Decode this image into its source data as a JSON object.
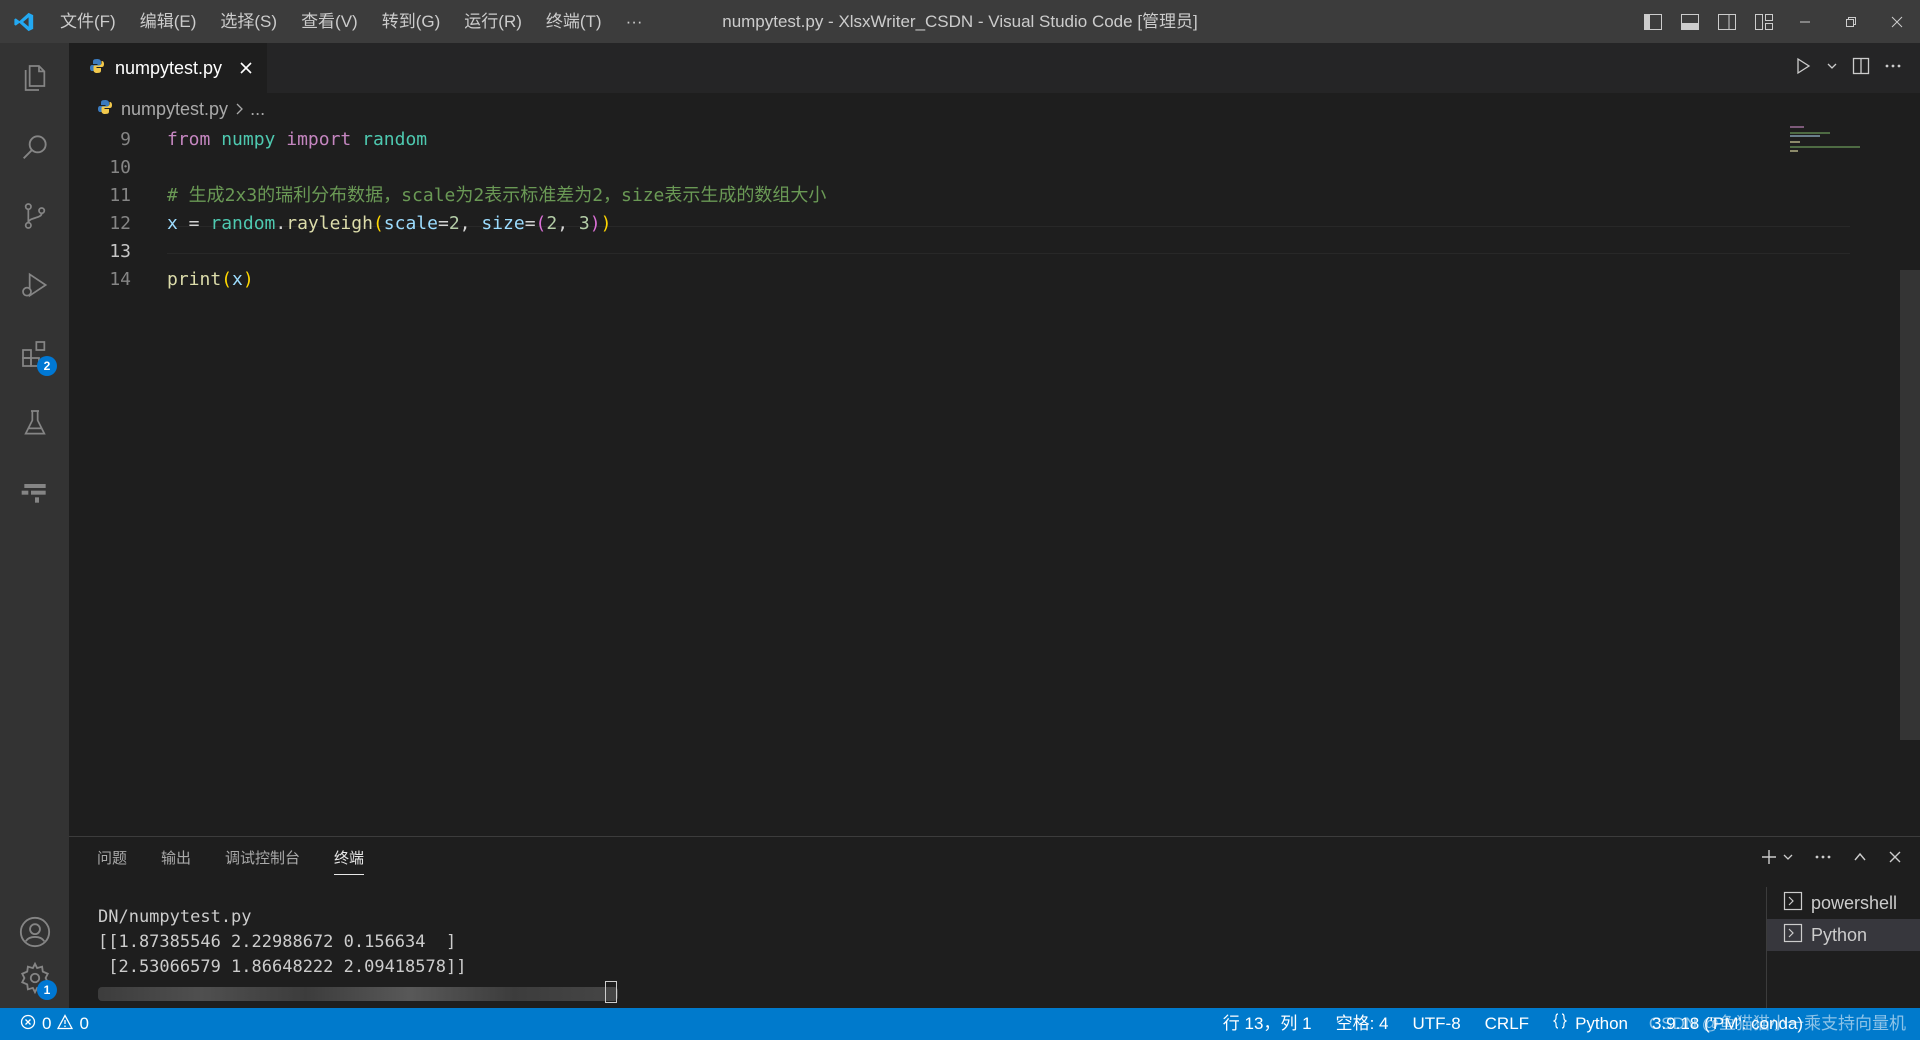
{
  "titlebar": {
    "menu": [
      "文件(F)",
      "编辑(E)",
      "选择(S)",
      "查看(V)",
      "转到(G)",
      "运行(R)",
      "终端(T)",
      "···"
    ],
    "window_title": "numpytest.py - XlsxWriter_CSDN - Visual Studio Code [管理员]"
  },
  "activitybar": {
    "items": [
      "files-icon",
      "search-icon",
      "source-control-icon",
      "run-debug-icon",
      "extensions-icon",
      "testing-icon",
      "remote-icon"
    ],
    "extensions_badge": "2",
    "settings_badge": "1"
  },
  "tabs": [
    {
      "label": "numpytest.py",
      "active": true
    }
  ],
  "breadcrumb": {
    "file": "numpytest.py",
    "rest": "..."
  },
  "editor": {
    "current_line": "13",
    "lines": [
      {
        "num": "9",
        "tokens": [
          [
            "kw",
            "from"
          ],
          [
            "op",
            " "
          ],
          [
            "mod",
            "numpy"
          ],
          [
            "op",
            " "
          ],
          [
            "kw",
            "import"
          ],
          [
            "op",
            " "
          ],
          [
            "mod",
            "random"
          ]
        ]
      },
      {
        "num": "10",
        "tokens": []
      },
      {
        "num": "11",
        "tokens": [
          [
            "cm",
            "# 生成2x3的瑞利分布数据，scale为2表示标准差为2，size表示生成的数组大小"
          ]
        ]
      },
      {
        "num": "12",
        "tokens": [
          [
            "var",
            "x"
          ],
          [
            "op",
            " = "
          ],
          [
            "mod",
            "random"
          ],
          [
            "op",
            "."
          ],
          [
            "fn",
            "rayleigh"
          ],
          [
            "br1",
            "("
          ],
          [
            "var",
            "scale"
          ],
          [
            "op",
            "="
          ],
          [
            "num",
            "2"
          ],
          [
            "op",
            ", "
          ],
          [
            "var",
            "size"
          ],
          [
            "op",
            "="
          ],
          [
            "br2",
            "("
          ],
          [
            "num",
            "2"
          ],
          [
            "op",
            ", "
          ],
          [
            "num",
            "3"
          ],
          [
            "br2",
            ")"
          ],
          [
            "br1",
            ")"
          ]
        ]
      },
      {
        "num": "13",
        "tokens": []
      },
      {
        "num": "14",
        "tokens": [
          [
            "fn",
            "print"
          ],
          [
            "br1",
            "("
          ],
          [
            "var",
            "x"
          ],
          [
            "br1",
            ")"
          ]
        ]
      }
    ]
  },
  "panel": {
    "tabs": [
      "问题",
      "输出",
      "调试控制台",
      "终端"
    ],
    "active_tab": "终端",
    "terminal_output": "DN/numpytest.py\n[[1.87385546 2.22988672 0.156634  ]\n [2.53066579 1.86648222 2.09418578]]",
    "terminals": [
      "powershell",
      "Python"
    ]
  },
  "statusbar": {
    "errors": "0",
    "warnings": "0",
    "position": "行 13，列 1",
    "spaces": "空格: 4",
    "encoding": "UTF-8",
    "eol": "CRLF",
    "language": "Python",
    "interpreter": "3.9.18 ('PM': conda)",
    "watermark": "CSDN @鱼猫猫小一乘支持向量机"
  },
  "colors": {
    "accent": "#007acc",
    "titlebar": "#3c3c3c",
    "activitybar": "#333333",
    "editor_bg": "#1e1e1e"
  }
}
